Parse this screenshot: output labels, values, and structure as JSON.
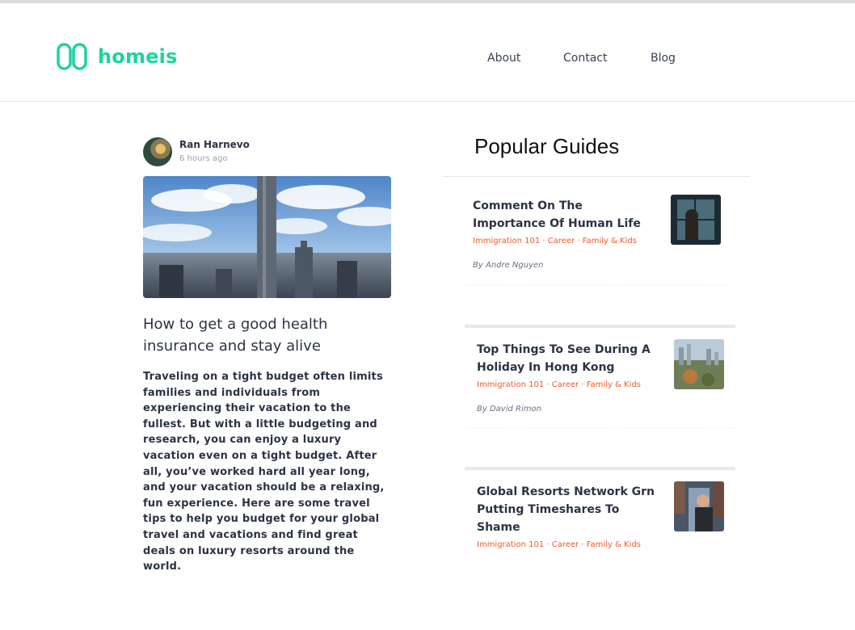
{
  "header": {
    "logo_text": "homeis",
    "nav": [
      {
        "label": "About"
      },
      {
        "label": "Contact"
      },
      {
        "label": "Blog"
      }
    ]
  },
  "post": {
    "author_name": "Ran Harnevo",
    "time_ago": "6 hours ago",
    "title": "How to get a good health insurance and stay alive",
    "body": "Traveling on a tight budget often limits families and individuals from experiencing their vacation to the fullest. But with a little budgeting and research, you can enjoy a luxury vacation even on a tight budget. After all, you’ve worked hard all year long, and your vacation should be a relaxing, fun experience. Here are some travel tips to help you budget for your global travel and vacations and find great deals on luxury resorts around the world."
  },
  "guides": {
    "heading": "Popular Guides",
    "items": [
      {
        "title": "Comment On The Importance Of Human Life",
        "tags": "Immigration 101 · Career · Family & Kids",
        "author": "By Andre Nguyen"
      },
      {
        "title": "Top Things To See During A Holiday In Hong Kong",
        "tags": "Immigration 101 · Career · Family & Kids",
        "author": "By David Rimon"
      },
      {
        "title": "Global Resorts Network Grn Putting Timeshares To Shame",
        "tags": "Immigration 101 · Career · Family & Kids",
        "author": ""
      }
    ]
  },
  "colors": {
    "brand": "#1dd3a0",
    "tag": "#f05a28",
    "text": "#2c3345"
  }
}
